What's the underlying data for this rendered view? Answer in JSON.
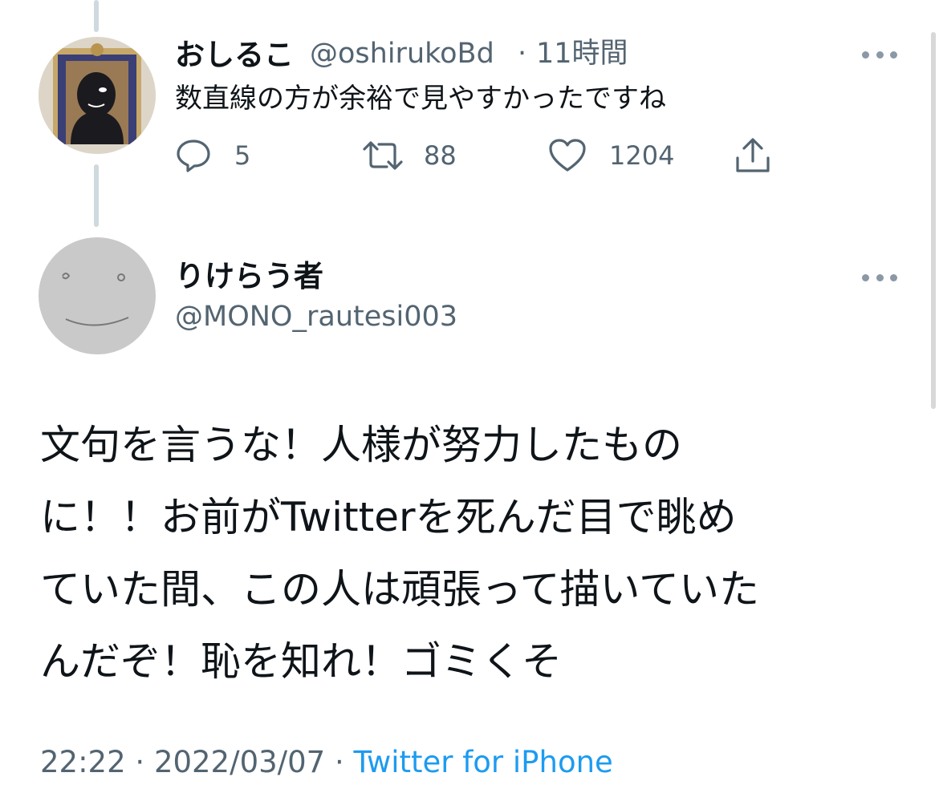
{
  "reply_tweet": {
    "display_name": "おしるこ",
    "handle": "@oshirukoBd",
    "separator": "·",
    "time": "11時間",
    "text": "数直線の方が余裕で見やすかったですね",
    "replies": "5",
    "retweets": "88",
    "likes": "1204"
  },
  "main_tweet": {
    "display_name": "りけらう者",
    "handle": "@MONO_rautesi003",
    "text_lines": [
      "文句を言うな！人様が努力したもの",
      "に！！お前がTwitterを死んだ目で眺め",
      "ていた間、この人は頑張って描いていた",
      "んだぞ！恥を知れ！ゴミくそ"
    ],
    "time": "22:22",
    "separator": "·",
    "date": "2022/03/07",
    "source": "Twitter for iPhone"
  },
  "icons": {
    "reply": "reply-icon",
    "retweet": "retweet-icon",
    "like": "heart-icon",
    "share": "share-icon",
    "more": "more-options-icon"
  },
  "colors": {
    "text": "#0f1419",
    "secondary": "#536471",
    "link": "#1d9bf0",
    "thread_line": "#cfd9de"
  }
}
